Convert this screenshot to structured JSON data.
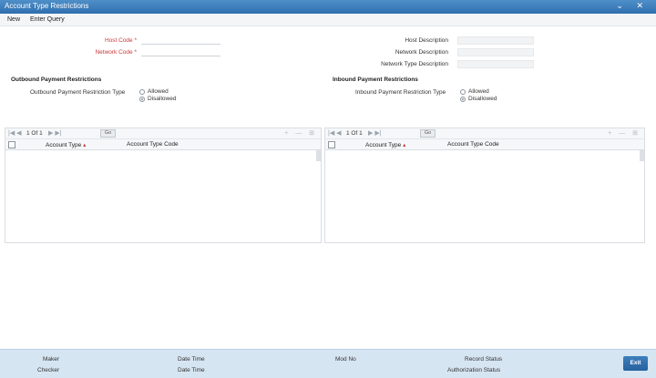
{
  "window": {
    "title": "Account Type Restrictions",
    "controls": "⌄ ✕"
  },
  "menu": {
    "new": "New",
    "enter_query": "Enter Query"
  },
  "form": {
    "host_code_label": "Host Code *",
    "network_code_label": "Network Code *",
    "host_description_label": "Host Description",
    "network_description_label": "Network Description",
    "network_type_description_label": "Network Type Description"
  },
  "outbound": {
    "title": "Outbound Payment Restrictions",
    "type_label": "Outbound Payment Restriction Type",
    "allowed": "Allowed",
    "disallowed": "Disallowed",
    "selected": "Disallowed"
  },
  "inbound": {
    "title": "Inbound Payment Restrictions",
    "type_label": "Inbound Payment Restriction Type",
    "allowed": "Allowed",
    "disallowed": "Disallowed",
    "selected": "Disallowed"
  },
  "grid_left": {
    "pager": "1 Of 1",
    "go": "Go",
    "col_account_type": "Account Type",
    "col_account_type_code": "Account Type Code"
  },
  "grid_right": {
    "pager": "1 Of 1",
    "go": "Go",
    "col_account_type": "Account Type",
    "col_account_type_code": "Account Type Code"
  },
  "footer": {
    "maker": "Maker",
    "checker": "Checker",
    "date_time_1": "Date Time",
    "date_time_2": "Date Time",
    "mod_no": "Mod No",
    "record_status": "Record Status",
    "authorization_status": "Authorization Status",
    "exit": "Exit"
  }
}
